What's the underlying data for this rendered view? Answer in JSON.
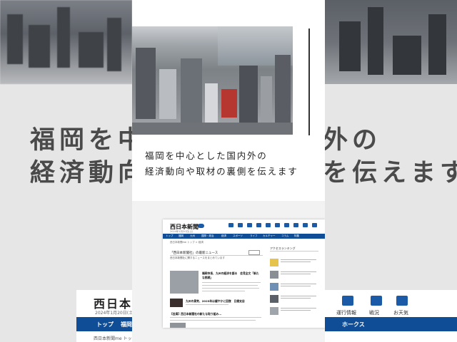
{
  "background": {
    "headline_line1": "福岡を中心とした国内外の",
    "headline_line2": "経済動向や取材の裏側を伝えます",
    "site": {
      "logo": "西日本新聞",
      "date": "2024年1月20日(土)",
      "nav": [
        "トップ",
        "福岡",
        "ホークス"
      ],
      "crumb": "西日本新聞me トップ",
      "icons": [
        "運行情報",
        "戦況",
        "お天気"
      ]
    }
  },
  "card": {
    "tagline_line1": "福岡を中心とした国内外の",
    "tagline_line2": "経済動向や取材の裏側を伝えます",
    "photo_alt": "city-aerial-photo",
    "mini_site": {
      "logo": "西日本新聞",
      "badge": "me",
      "date": "2024年1月20日(土)",
      "nav": [
        "トップ",
        "福岡",
        "九州",
        "国際・政治",
        "経済",
        "スポーツ",
        "ライフ",
        "カルチャー",
        "コラム",
        "特集"
      ],
      "crumb": "西日本新聞me トップ > 経済",
      "section_title": "「西日本新聞社」の最新ニュース",
      "section_sub": "西日本新聞社に関するニュースをまとめています",
      "articles": [
        {
          "title": "福岡市長、九州の経済を語る　会見全文「新た",
          "subtitle": "な挑戦」"
        },
        {
          "title": "九州の景気、2023年は緩やかに回復　日銀支店",
          "subtitle": ""
        },
        {
          "title": "【会員】西日本新聞社の新たな取り組み…",
          "subtitle": ""
        }
      ],
      "sidebar_title": "アクセスランキング",
      "sidebar_count": 5
    }
  },
  "colors": {
    "nav_blue": "#0f4e96",
    "accent_blue": "#1a5aa6"
  }
}
